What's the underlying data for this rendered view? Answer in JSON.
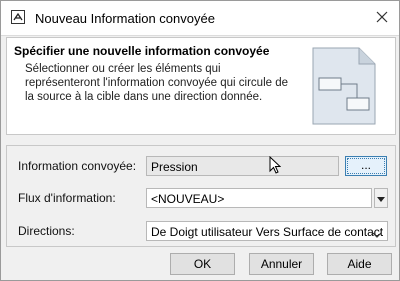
{
  "window": {
    "title": "Nouveau Information convoyée",
    "close_glyph": "✕"
  },
  "banner": {
    "heading": "Spécifier une nouvelle information convoyée",
    "description": "Sélectionner ou créer les éléments qui représenteront l'information convoyée qui circule de la source à la cible dans une direction donnée."
  },
  "form": {
    "info_label": "Information convoyée:",
    "info_value": "Pression",
    "browse_label": "...",
    "flux_label": "Flux d'information:",
    "flux_value": "<NOUVEAU>",
    "directions_label": "Directions:",
    "directions_value": "De Doigt utilisateur Vers Surface de contact"
  },
  "buttons": {
    "ok": "OK",
    "cancel": "Annuler",
    "help": "Aide"
  }
}
